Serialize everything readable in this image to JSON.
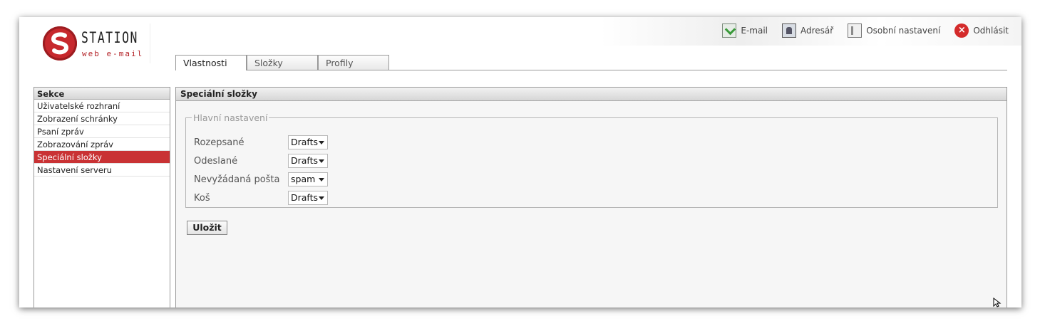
{
  "logo": {
    "name": "STATION",
    "subtitle": "web e-mail"
  },
  "toplinks": [
    {
      "label": "E-mail",
      "icon": "mail-download-icon"
    },
    {
      "label": "Adresář",
      "icon": "address-book-icon"
    },
    {
      "label": "Osobní nastavení",
      "icon": "personal-settings-icon"
    },
    {
      "label": "Odhlásit",
      "icon": "logout-icon"
    }
  ],
  "tabs": [
    "Vlastnosti",
    "Složky",
    "Profily"
  ],
  "sidebar": {
    "title": "Sekce",
    "items": [
      "Uživatelské rozhraní",
      "Zobrazení schránky",
      "Psaní zpráv",
      "Zobrazování zpráv",
      "Speciální složky",
      "Nastavení serveru"
    ],
    "active_index": 4
  },
  "main": {
    "title": "Speciální složky",
    "fieldset_legend": "Hlavní nastavení",
    "fields": [
      {
        "label": "Rozepsané",
        "value": "Drafts"
      },
      {
        "label": "Odeslané",
        "value": "Drafts"
      },
      {
        "label": "Nevyžádaná pošta",
        "value": "spam"
      },
      {
        "label": "Koš",
        "value": "Drafts"
      }
    ],
    "save_label": "Uložit"
  },
  "colors": {
    "accent_red": "#c93234",
    "brand_red": "#c7282d"
  }
}
